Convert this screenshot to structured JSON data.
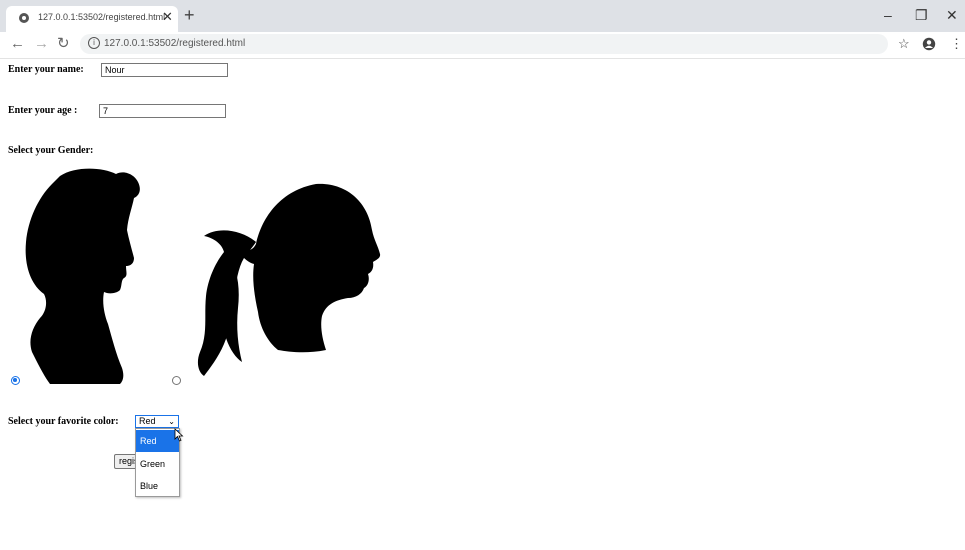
{
  "browser": {
    "tab_title": "127.0.0.1:53502/registered.html",
    "url": "127.0.0.1:53502/registered.html",
    "icons": [
      "globe-icon",
      "close-icon",
      "plus-icon",
      "minimize-icon",
      "restore-icon",
      "close-window-icon",
      "back-arrow-icon",
      "forward-arrow-icon",
      "reload-icon",
      "info-icon",
      "star-icon",
      "profile-icon",
      "menu-icon"
    ]
  },
  "form": {
    "name_label": "Enter your name:",
    "name_value": "Nour",
    "age_label": "Enter your age :",
    "age_value": "7",
    "gender_label": "Select your Gender:",
    "gender_options": [
      {
        "value": "male",
        "selected": true
      },
      {
        "value": "female",
        "selected": false
      }
    ],
    "color_label": "Select your favorite color:",
    "color_selected": "Red",
    "color_options": [
      "Red",
      "Green",
      "Blue"
    ],
    "submit_label": "register"
  },
  "colors": {
    "accent": "#1a73e8",
    "tabbar": "#dee1e6"
  }
}
